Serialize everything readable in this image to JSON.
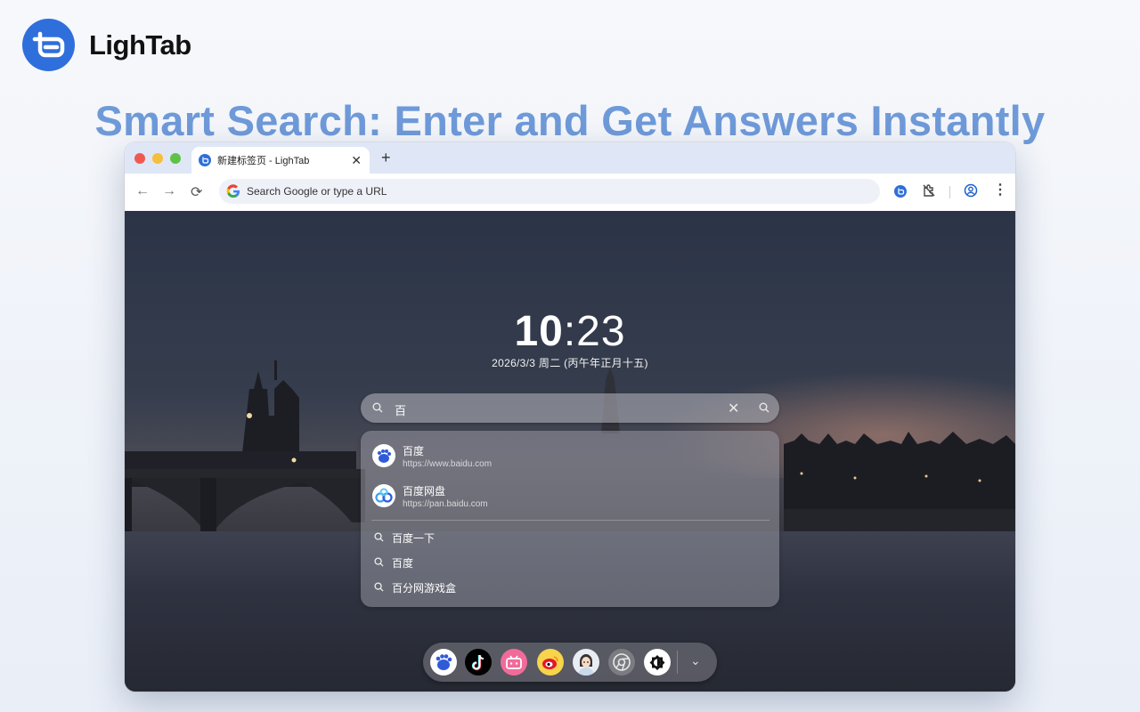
{
  "brand": {
    "name": "LighTab",
    "accent": "#2f6fdc"
  },
  "headline": "Smart Search: Enter and Get Answers Instantly",
  "browser": {
    "tab": {
      "title": "新建标签页 - LighTab",
      "favicon": "lightab-icon"
    },
    "omnibox": {
      "placeholder": "Search Google or type a URL"
    },
    "toolbar_icons": [
      "back-icon",
      "forward-icon",
      "reload-icon",
      "lightab-extension-icon",
      "extensions-puzzle-icon",
      "profile-icon",
      "menu-kebab-icon"
    ]
  },
  "newtab": {
    "clock": {
      "hour": "10",
      "separator": ":",
      "minute": "23"
    },
    "date": "2026/3/3 周二 (丙午年正月十五)",
    "search": {
      "query": "百"
    },
    "suggestions": {
      "sites": [
        {
          "name": "百度",
          "url": "https://www.baidu.com",
          "icon": "baidu-icon"
        },
        {
          "name": "百度网盘",
          "url": "https://pan.baidu.com",
          "icon": "baidu-netdisk-icon"
        }
      ],
      "queries": [
        "百度一下",
        "百度",
        "百分网游戏盒"
      ]
    },
    "dock": {
      "apps": [
        "baidu-icon",
        "tiktok-icon",
        "bilibili-icon",
        "weibo-icon",
        "avatar-icon",
        "chrome-settings-icon",
        "theme-toggle-icon"
      ],
      "more": "chevron-down-icon"
    }
  }
}
